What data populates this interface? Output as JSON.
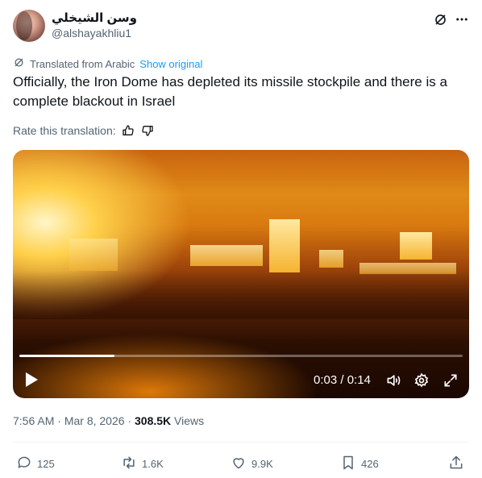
{
  "author": {
    "display_name": "وسن الشيخلي",
    "handle": "@alshayakhliu1"
  },
  "translation": {
    "notice": "Translated from Arabic",
    "show_original": "Show original",
    "rate_label": "Rate this translation:"
  },
  "tweet": {
    "text": "Officially, the Iron Dome has depleted its missile stockpile and there is a complete blackout in Israel"
  },
  "video": {
    "current_time": "0:03",
    "separator": " / ",
    "duration": "0:14",
    "progress": 0.214
  },
  "meta": {
    "time": "7:56 AM",
    "dot1": " · ",
    "date": "Mar 8, 2026",
    "dot2": " · ",
    "views_count": "308.5K",
    "views_label": " Views"
  },
  "actions": {
    "replies": "125",
    "reposts": "1.6K",
    "likes": "9.9K",
    "bookmarks": "426"
  },
  "colors": {
    "accent": "#1d9bf0",
    "secondary_text": "#536471",
    "primary_text": "#0f1419"
  }
}
